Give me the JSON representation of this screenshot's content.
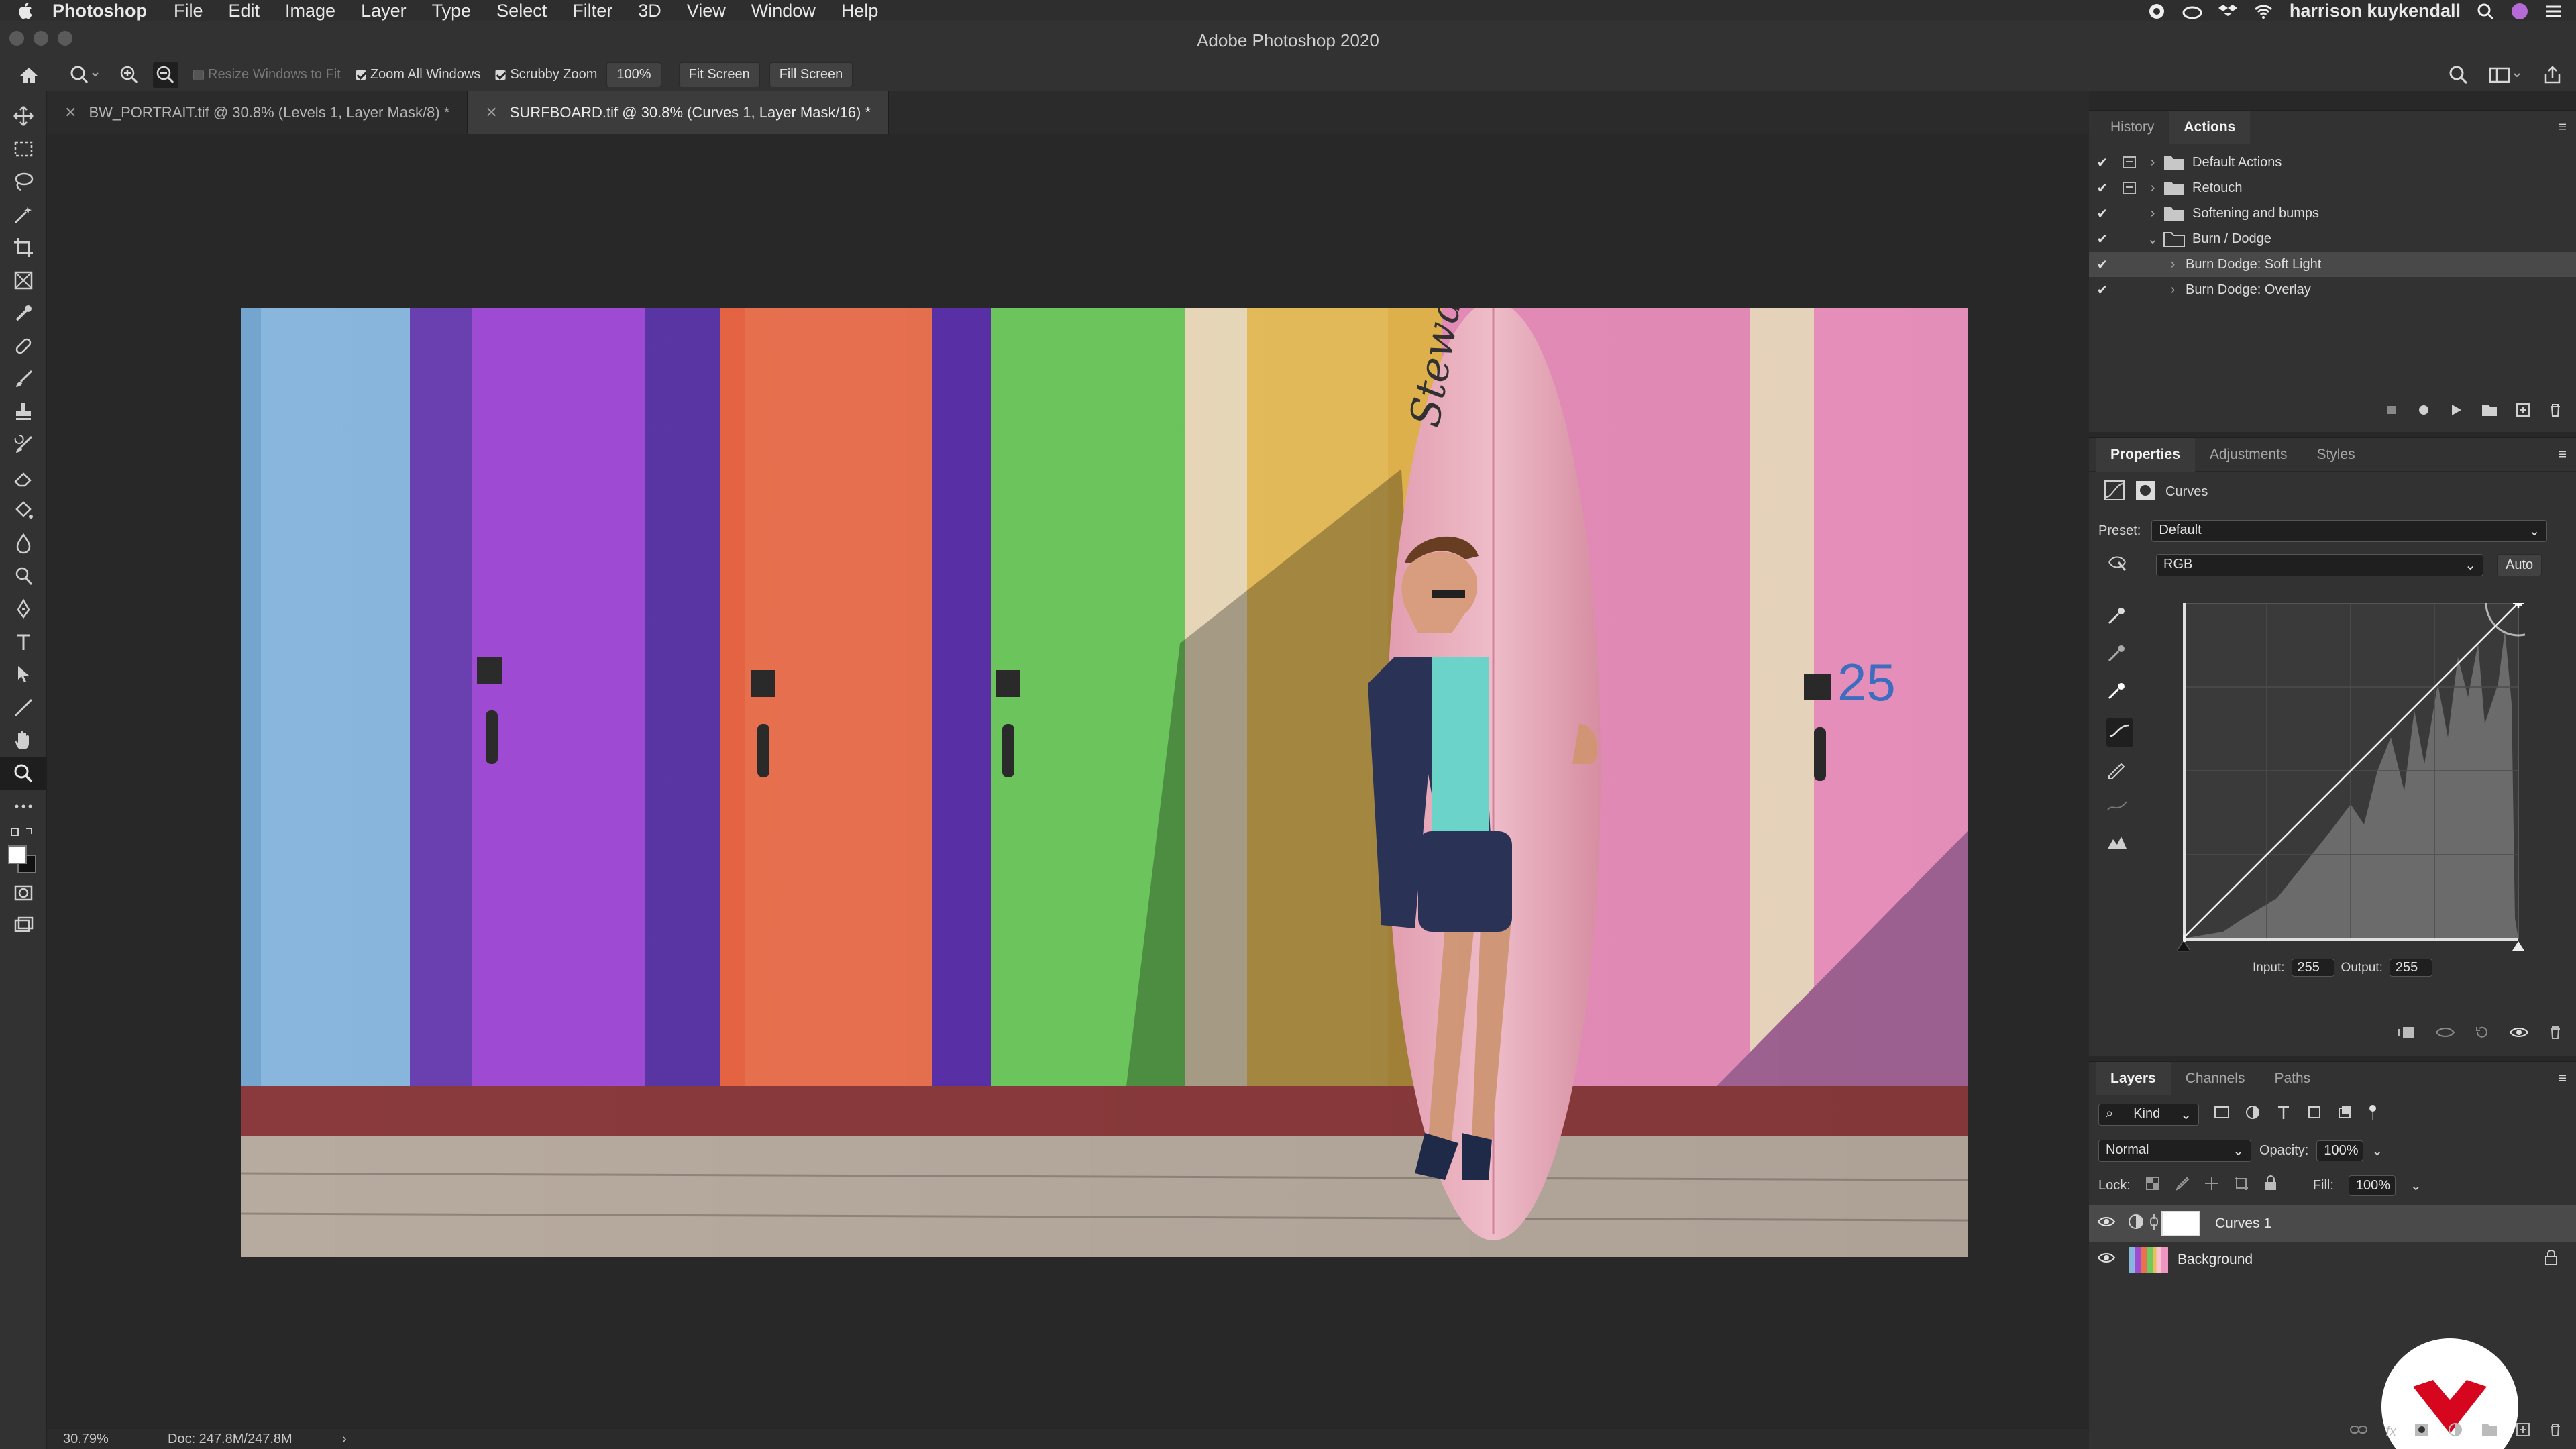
{
  "menubar": {
    "app": "Photoshop",
    "items": [
      "File",
      "Edit",
      "Image",
      "Layer",
      "Type",
      "Select",
      "Filter",
      "3D",
      "View",
      "Window",
      "Help"
    ],
    "user": "harrison kuykendall"
  },
  "window": {
    "title": "Adobe Photoshop 2020"
  },
  "options": {
    "resize_windows": "Resize Windows to Fit",
    "zoom_all": "Zoom All Windows",
    "scrubby": "Scrubby Zoom",
    "zoom_value": "100%",
    "fit_screen": "Fit Screen",
    "fill_screen": "Fill Screen"
  },
  "tabs": [
    {
      "label": "BW_PORTRAIT.tif @ 30.8% (Levels 1, Layer Mask/8) *"
    },
    {
      "label": "SURFBOARD.tif @ 30.8% (Curves 1, Layer Mask/16) *"
    }
  ],
  "status": {
    "zoom": "30.79%",
    "doc": "Doc: 247.8M/247.8M"
  },
  "actions_panel": {
    "tabs": [
      "History",
      "Actions"
    ],
    "items": [
      {
        "label": "Default Actions",
        "type": "folder",
        "level": 0
      },
      {
        "label": "Retouch",
        "type": "folder",
        "level": 0
      },
      {
        "label": "Softening and bumps",
        "type": "folder",
        "level": 0
      },
      {
        "label": "Burn / Dodge",
        "type": "folder",
        "level": 0
      },
      {
        "label": "Burn Dodge: Soft Light",
        "type": "action",
        "level": 1
      },
      {
        "label": "Burn Dodge: Overlay",
        "type": "action",
        "level": 1
      }
    ]
  },
  "properties_panel": {
    "tabs": [
      "Properties",
      "Adjustments",
      "Styles"
    ],
    "title": "Curves",
    "preset_label": "Preset:",
    "preset_value": "Default",
    "channel": "RGB",
    "auto": "Auto",
    "input_label": "Input:",
    "input_value": "255",
    "output_label": "Output:",
    "output_value": "255"
  },
  "layers_panel": {
    "tabs": [
      "Layers",
      "Channels",
      "Paths"
    ],
    "kind": "Kind",
    "blend": "Normal",
    "opacity_label": "Opacity:",
    "opacity_value": "100%",
    "lock_label": "Lock:",
    "fill_label": "Fill:",
    "fill_value": "100%",
    "layers": [
      {
        "name": "Curves 1"
      },
      {
        "name": "Background"
      }
    ]
  },
  "photo": {
    "board_text": "Stewart",
    "number_text": "25"
  },
  "colors": {
    "accent": "#d7061f",
    "panel": "#323232",
    "canvas": "#282828"
  }
}
